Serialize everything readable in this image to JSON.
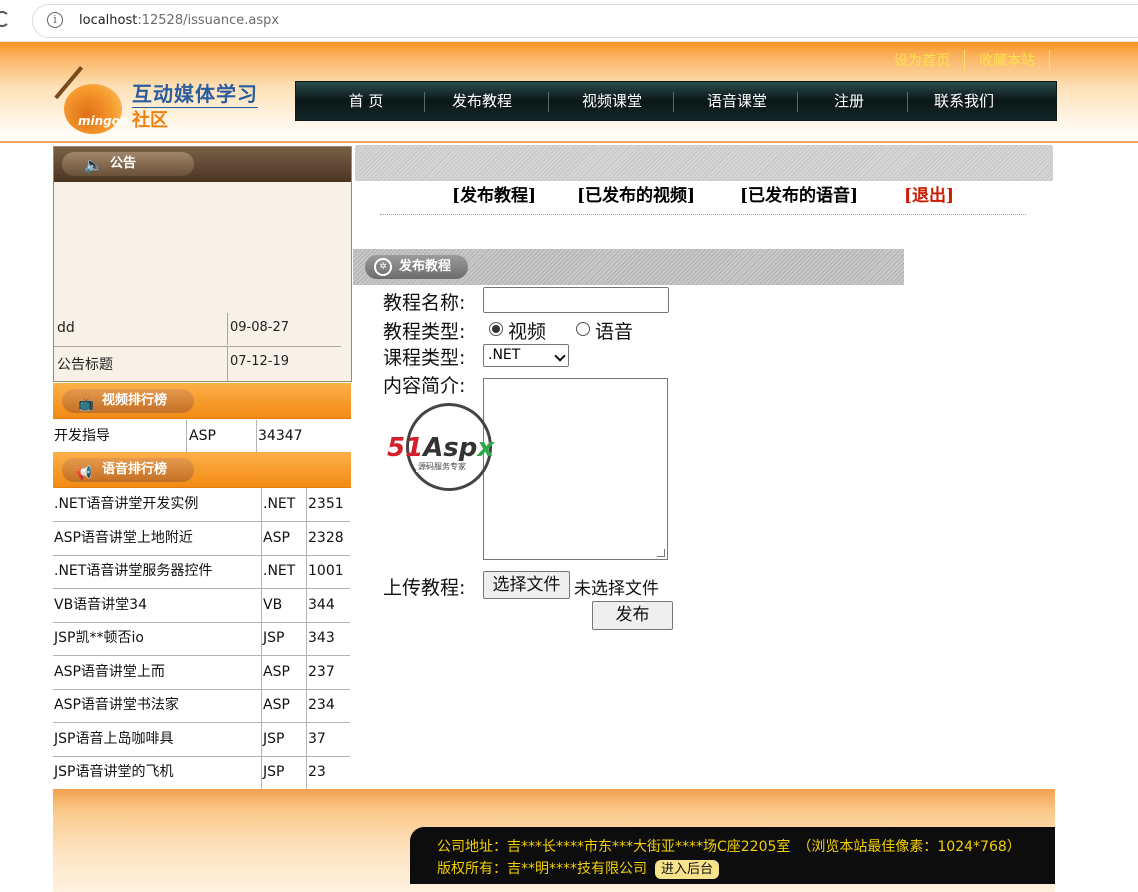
{
  "browser": {
    "url_host": "localhost",
    "url_rest": ":12528/issuance.aspx"
  },
  "header": {
    "top_links": [
      "设为首页",
      "收藏本站"
    ],
    "logo_title": "互动媒体学习",
    "logo_sub": "社区",
    "logo_brand": "mingoo",
    "nav": [
      "首 页",
      "发布教程",
      "视频课堂",
      "语音课堂",
      "注册",
      "联系我们"
    ]
  },
  "notice": {
    "title": "公告",
    "rows": [
      {
        "title": "dd",
        "date": "09-08-27"
      },
      {
        "title": "公告标题",
        "date": "07-12-19"
      }
    ]
  },
  "video_rank": {
    "title": "视频排行榜",
    "rows": [
      {
        "name": "开发指导",
        "type": "ASP",
        "count": "34347"
      }
    ]
  },
  "audio_rank": {
    "title": "语音排行榜",
    "rows": [
      {
        "name": ".NET语音讲堂开发实例",
        "type": ".NET",
        "count": "2351"
      },
      {
        "name": "ASP语音讲堂上地附近",
        "type": "ASP",
        "count": "2328"
      },
      {
        "name": ".NET语音讲堂服务器控件",
        "type": ".NET",
        "count": "1001"
      },
      {
        "name": "VB语音讲堂34",
        "type": "VB",
        "count": "344"
      },
      {
        "name": "JSP凯**顿否io",
        "type": "JSP",
        "count": "343"
      },
      {
        "name": "ASP语音讲堂上而",
        "type": "ASP",
        "count": "237"
      },
      {
        "name": "ASP语音讲堂书法家",
        "type": "ASP",
        "count": "234"
      },
      {
        "name": "JSP语音上岛咖啡具",
        "type": "JSP",
        "count": "37"
      },
      {
        "name": "JSP语音讲堂的飞机",
        "type": "JSP",
        "count": "23"
      }
    ]
  },
  "tabs": [
    "[发布教程]",
    "[已发布的视频]",
    "[已发布的语音]",
    "[退出]"
  ],
  "form": {
    "section_title": "发布教程",
    "name_label": "教程名称:",
    "name_value": "",
    "type_label": "教程类型:",
    "type_options": [
      "视频",
      "语音"
    ],
    "type_selected": "视频",
    "course_label": "课程类型:",
    "course_value": ".NET",
    "intro_label": "内容简介:",
    "upload_label": "上传教程:",
    "file_button": "选择文件",
    "file_status": "未选择文件",
    "submit": "发布"
  },
  "watermark": {
    "brand_51": "51",
    "brand_asp": "Asp",
    "brand_x": "x",
    "sub": "源码服务专家"
  },
  "footer": {
    "address": "公司地址：吉***长****市东***大街亚****场C座2205室　（浏览本站最佳像素：1024*768）",
    "copyright": "版权所有：吉**明****技有限公司",
    "admin": "进入后台"
  }
}
